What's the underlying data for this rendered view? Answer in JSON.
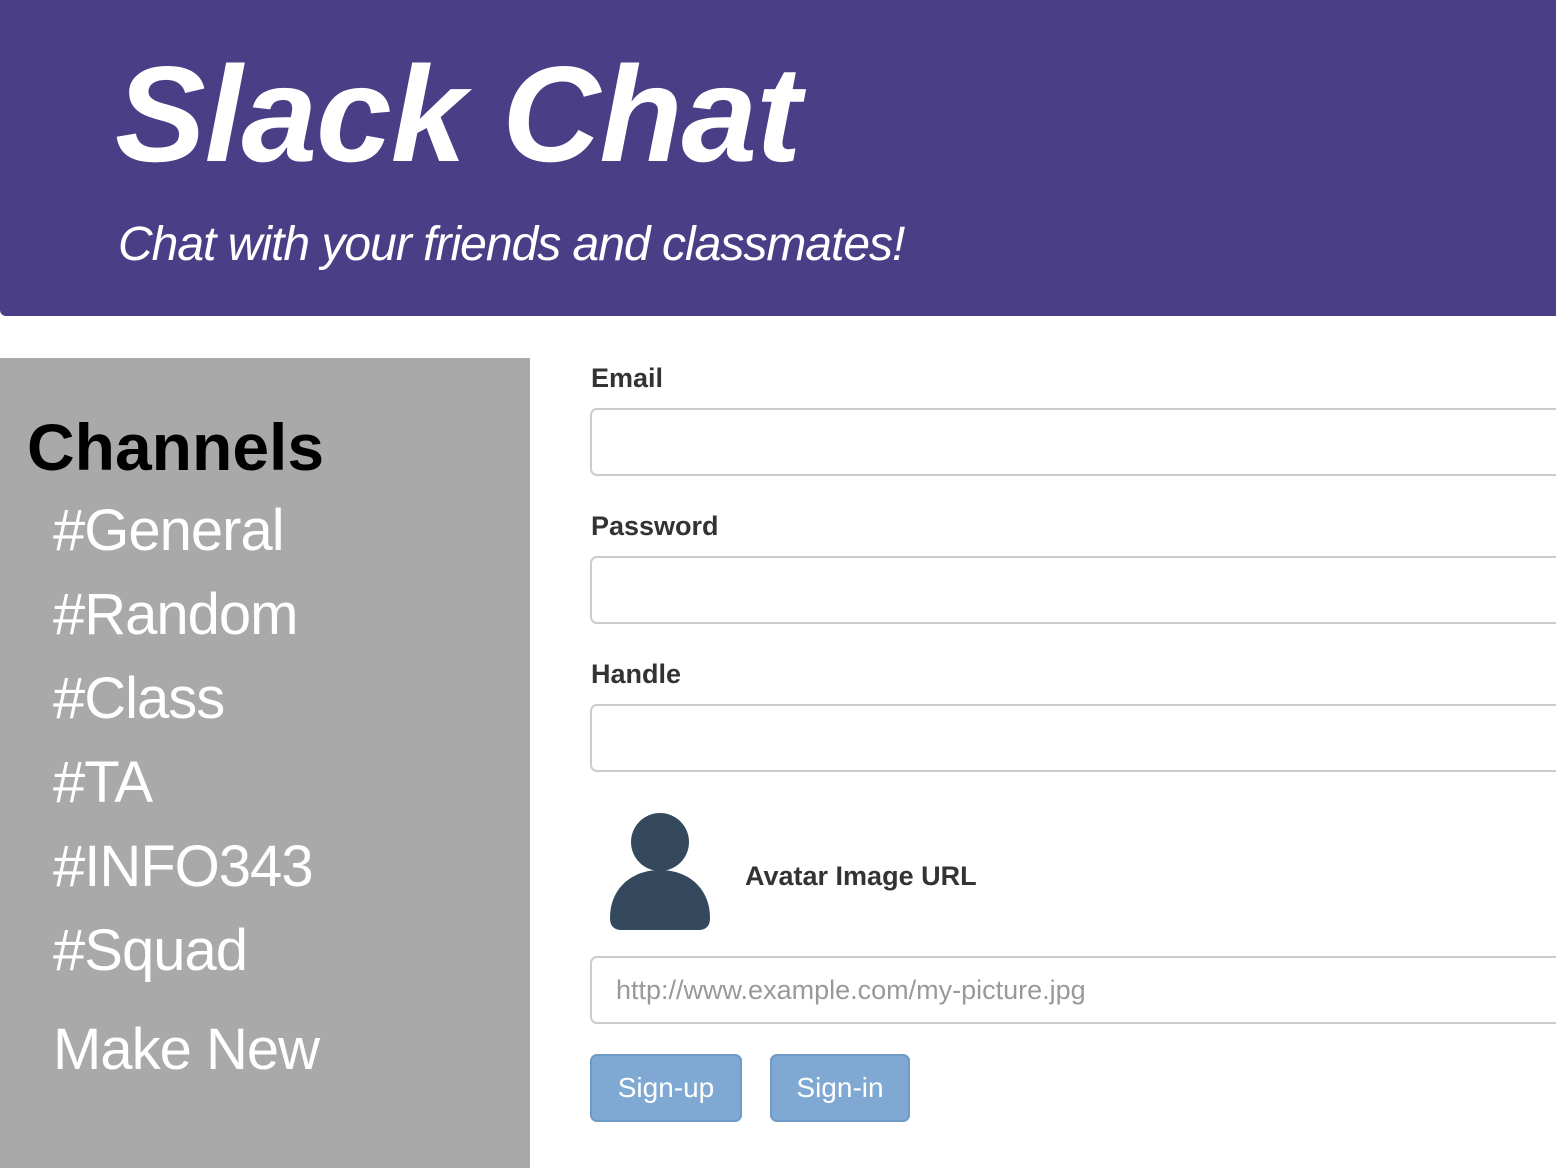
{
  "header": {
    "title": "Slack Chat",
    "subtitle": "Chat with your friends and classmates!",
    "background_color": "#4a3f87"
  },
  "sidebar": {
    "heading": "Channels",
    "channels": [
      "#General",
      "#Random",
      "#Class",
      "#TA",
      "#INFO343",
      "#Squad"
    ],
    "make_new_label": "Make New",
    "background_color": "#a9a9a9"
  },
  "form": {
    "email": {
      "label": "Email",
      "value": "",
      "placeholder": ""
    },
    "password": {
      "label": "Password",
      "value": "",
      "placeholder": ""
    },
    "handle": {
      "label": "Handle",
      "value": "",
      "placeholder": ""
    },
    "avatar": {
      "icon": "user-silhouette-icon",
      "label": "Avatar Image URL",
      "value": "",
      "placeholder": "http://www.example.com/my-picture.jpg"
    },
    "buttons": {
      "signup_label": "Sign-up",
      "signin_label": "Sign-in",
      "button_color": "#7fa9d2"
    }
  }
}
